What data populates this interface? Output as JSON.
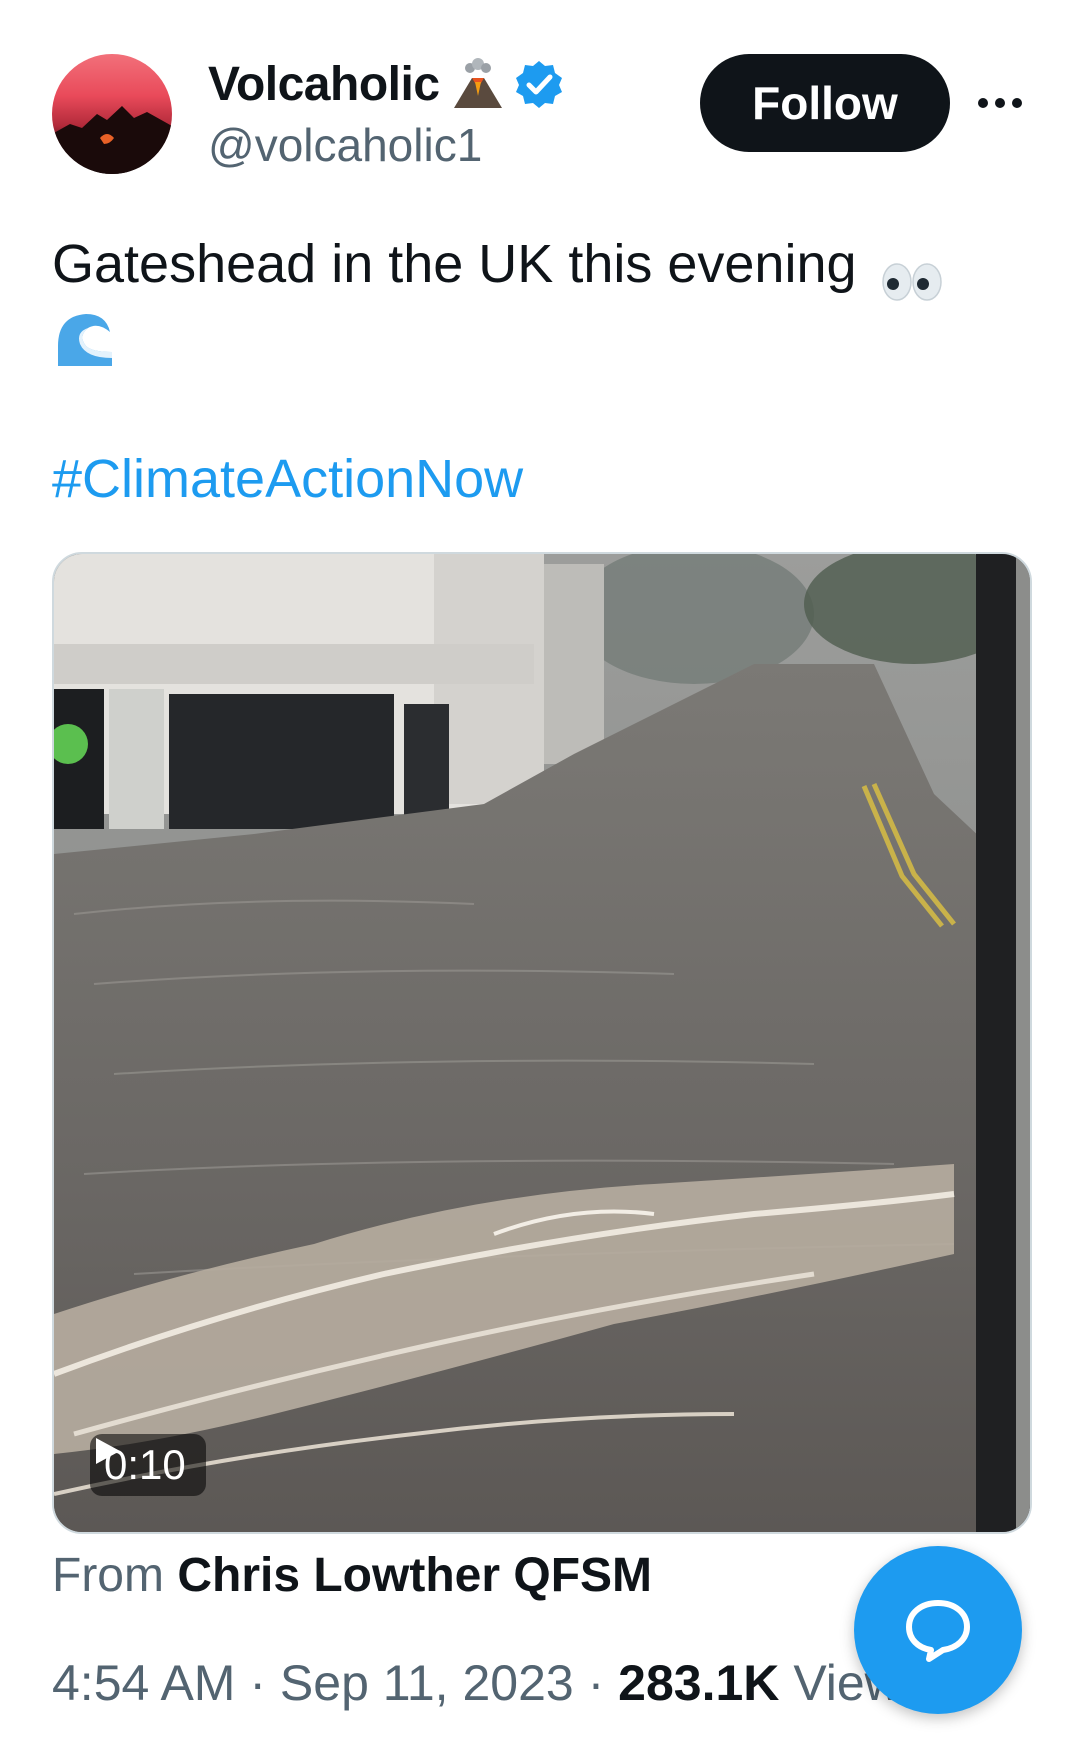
{
  "author": {
    "display_name": "Volcaholic",
    "handle": "@volcaholic1",
    "name_emoji": "volcano-icon",
    "verified": true
  },
  "follow_button": {
    "label": "Follow"
  },
  "more_menu": {
    "icon": "more-horizontal-icon"
  },
  "tweet": {
    "text": "Gateshead in the UK this evening",
    "emojis": [
      "eyes-icon",
      "wave-icon"
    ],
    "hashtag": "#ClimateActionNow"
  },
  "media": {
    "type": "video",
    "duration": "0:10",
    "play_icon": "play-icon"
  },
  "source": {
    "prefix": "From",
    "name": "Chris Lowther QFSM"
  },
  "meta": {
    "time": "4:54 AM",
    "separator": "·",
    "date": "Sep 11, 2023",
    "views_count": "283.1K",
    "views_label": "Views"
  },
  "colors": {
    "accent": "#1d9bf0",
    "text_primary": "#0f1419",
    "text_secondary": "#536471",
    "button_dark": "#0f1419"
  },
  "fab": {
    "icon": "chat-bubble-icon"
  }
}
